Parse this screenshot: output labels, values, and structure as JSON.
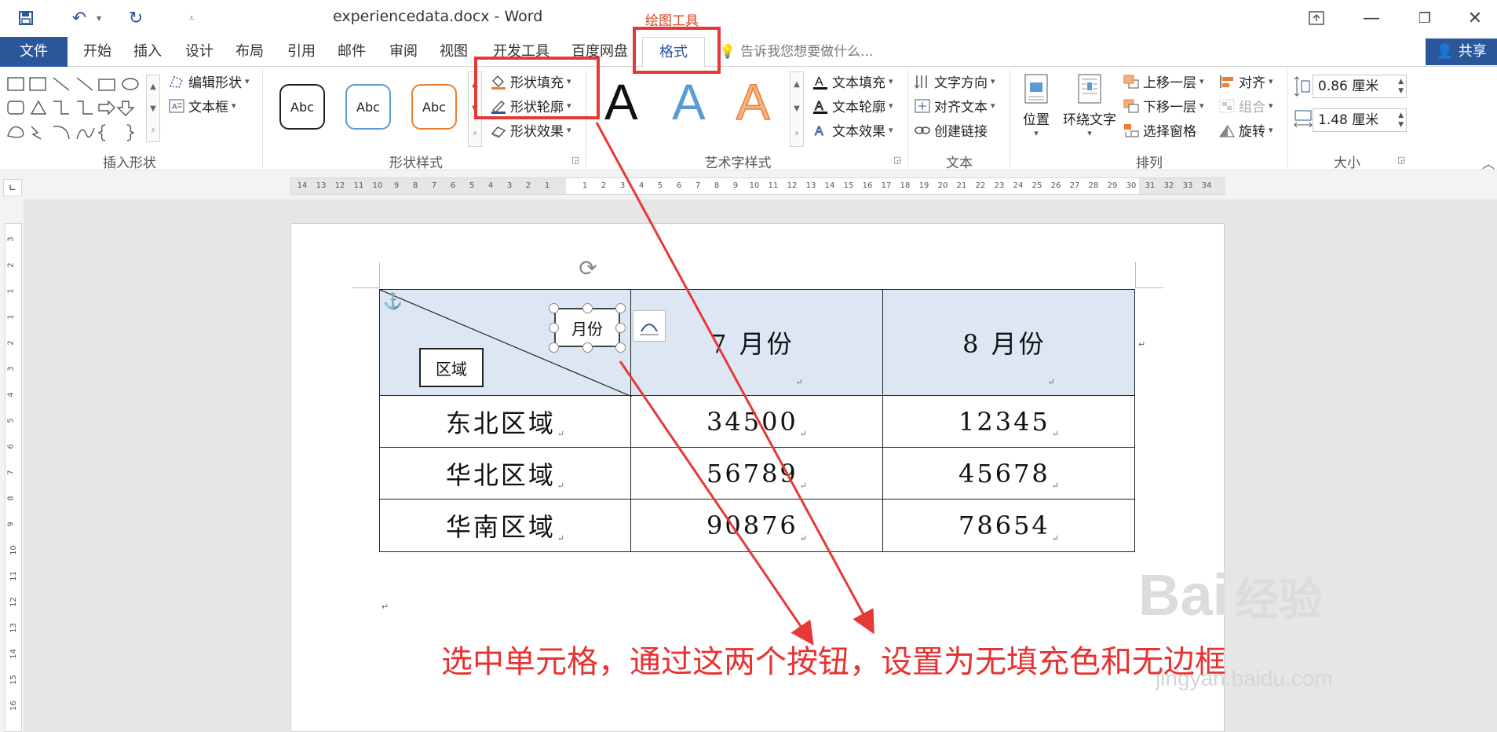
{
  "titlebar": {
    "document_title": "experiencedata.docx - Word",
    "context_title": "绘图工具",
    "quick_access": [
      "save-icon",
      "undo-icon",
      "redo-icon",
      "customize-icon"
    ],
    "window_controls": [
      "ribbon-display-icon",
      "minimize-icon",
      "restore-icon",
      "close-icon"
    ]
  },
  "tabs": [
    {
      "label": "文件"
    },
    {
      "label": "开始"
    },
    {
      "label": "插入"
    },
    {
      "label": "设计"
    },
    {
      "label": "布局"
    },
    {
      "label": "引用"
    },
    {
      "label": "邮件"
    },
    {
      "label": "审阅"
    },
    {
      "label": "视图"
    },
    {
      "label": "开发工具"
    },
    {
      "label": "百度网盘"
    },
    {
      "label": "格式"
    }
  ],
  "tell_me": "告诉我您想要做什么...",
  "share": "共享",
  "ribbon": {
    "insert_shapes": {
      "label": "插入形状",
      "edit_shape": "编辑形状",
      "text_box": "文本框"
    },
    "shape_styles": {
      "label": "形状样式",
      "gallery": [
        "Abc",
        "Abc",
        "Abc"
      ],
      "fill": "形状填充",
      "outline": "形状轮廓",
      "effects": "形状效果"
    },
    "wordart_styles": {
      "label": "艺术字样式",
      "gallery": [
        "A",
        "A",
        "A"
      ],
      "text_fill": "文本填充",
      "text_outline": "文本轮廓",
      "text_effects": "文本效果"
    },
    "text": {
      "label": "文本",
      "direction": "文字方向",
      "align": "对齐文本",
      "link": "创建链接"
    },
    "arrange": {
      "label": "排列",
      "position": "位置",
      "wrap": "环绕文字",
      "bring_forward": "上移一层",
      "send_backward": "下移一层",
      "selection_pane": "选择窗格",
      "align": "对齐",
      "group": "组合",
      "rotate": "旋转"
    },
    "size": {
      "label": "大小",
      "height": "0.86 厘米",
      "width": "1.48 厘米"
    }
  },
  "ruler": {
    "left_ticks": [
      "14",
      "13",
      "12",
      "11",
      "10",
      "9",
      "8",
      "7",
      "6",
      "5",
      "4",
      "3",
      "2",
      "1"
    ],
    "right_ticks": [
      "1",
      "2",
      "3",
      "4",
      "5",
      "6",
      "7",
      "8",
      "9",
      "10",
      "11",
      "12",
      "13",
      "14",
      "15",
      "16",
      "17",
      "18",
      "19",
      "20",
      "21",
      "22",
      "23",
      "24",
      "25",
      "26",
      "27",
      "28",
      "29",
      "30",
      "31",
      "32",
      "33",
      "34"
    ],
    "vertical_ticks": [
      "3",
      "2",
      "1",
      "1",
      "2",
      "3",
      "4",
      "5",
      "6",
      "7",
      "8",
      "9",
      "10",
      "11",
      "12",
      "13",
      "14",
      "15",
      "16"
    ]
  },
  "table": {
    "header": {
      "corner_top": "月份",
      "corner_bottom": "区域",
      "col1": "7 月份",
      "col2": "8 月份"
    },
    "rows": [
      {
        "region": "东北区域",
        "jul": "34500",
        "aug": "12345"
      },
      {
        "region": "华北区域",
        "jul": "56789",
        "aug": "45678"
      },
      {
        "region": "华南区域",
        "jul": "90876",
        "aug": "78654"
      }
    ]
  },
  "annotation": "选中单元格，通过这两个按钮，设置为无填充色和无边框",
  "watermark": {
    "brand": "Bai",
    "brand_cn": "经验",
    "url": "jingyan.baidu.com"
  },
  "colors": {
    "word_blue": "#2b579a",
    "context_orange": "#d24726",
    "highlight_red": "#e53935",
    "header_fill": "#dde7f4"
  }
}
